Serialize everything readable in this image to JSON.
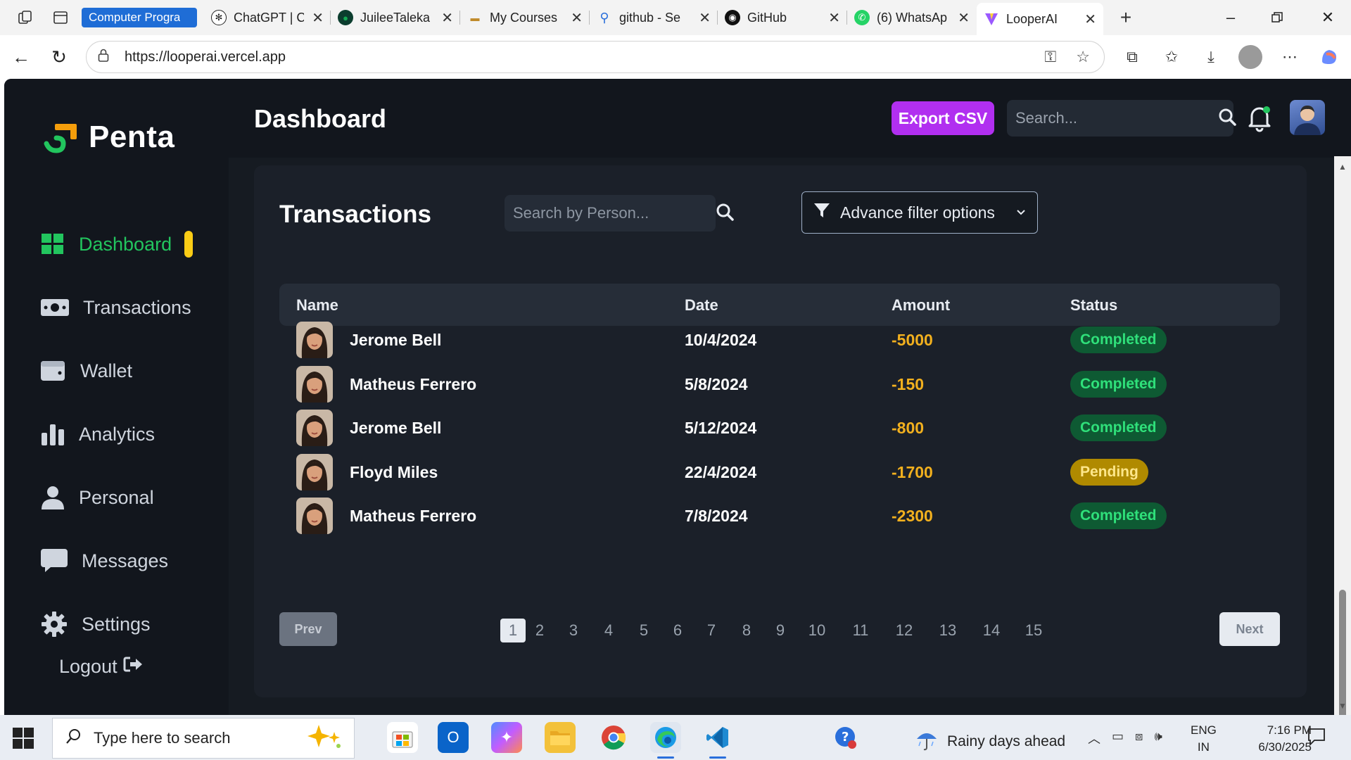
{
  "browser": {
    "tabs": [
      {
        "title": "Computer Progra",
        "favicon": "group",
        "color": "#1f6dd6"
      },
      {
        "title": "ChatGPT | C",
        "favicon": "chatgpt-icon",
        "color": "#222222"
      },
      {
        "title": "JuileeTaleka",
        "favicon": "mongodb-icon",
        "color": "#13aa52"
      },
      {
        "title": "My Courses",
        "favicon": "courses-icon",
        "color": "#c08a2a"
      },
      {
        "title": "github - Se",
        "favicon": "search-icon",
        "color": "#2a6fdb"
      },
      {
        "title": "GitHub",
        "favicon": "github-icon",
        "color": "#111111"
      },
      {
        "title": "(6) WhatsAp",
        "favicon": "whatsapp-icon",
        "color": "#25d366"
      },
      {
        "title": "LooperAI",
        "favicon": "vite-icon",
        "color": "#9b59ff"
      }
    ],
    "url": "https://looperai.vercel.app"
  },
  "app": {
    "brand": "Penta",
    "page_title": "Dashboard",
    "export_label": "Export CSV",
    "search_placeholder": "Search...",
    "sidebar": [
      {
        "label": "Dashboard",
        "icon": "grid-icon",
        "active": true
      },
      {
        "label": "Transactions",
        "icon": "money-icon",
        "active": false
      },
      {
        "label": "Wallet",
        "icon": "wallet-icon",
        "active": false
      },
      {
        "label": "Analytics",
        "icon": "bar-chart-icon",
        "active": false
      },
      {
        "label": "Personal",
        "icon": "user-icon",
        "active": false
      },
      {
        "label": "Messages",
        "icon": "message-icon",
        "active": false
      },
      {
        "label": "Settings",
        "icon": "gear-icon",
        "active": false
      }
    ],
    "logout_label": "Logout"
  },
  "transactions": {
    "title": "Transactions",
    "search_placeholder": "Search by Person...",
    "filter_label": "Advance filter options",
    "columns": [
      "Name",
      "Date",
      "Amount",
      "Status"
    ],
    "rows": [
      {
        "name": "Jerome Bell",
        "date": "10/4/2024",
        "amount": "-5000",
        "status": "Completed"
      },
      {
        "name": "Matheus Ferrero",
        "date": "5/8/2024",
        "amount": "-150",
        "status": "Completed"
      },
      {
        "name": "Jerome Bell",
        "date": "5/12/2024",
        "amount": "-800",
        "status": "Completed"
      },
      {
        "name": "Floyd Miles",
        "date": "22/4/2024",
        "amount": "-1700",
        "status": "Pending"
      },
      {
        "name": "Matheus Ferrero",
        "date": "7/8/2024",
        "amount": "-2300",
        "status": "Completed"
      }
    ],
    "prev_label": "Prev",
    "next_label": "Next",
    "pages": [
      "1",
      "2",
      "3",
      "4",
      "5",
      "6",
      "7",
      "8",
      "9",
      "10",
      "11",
      "12",
      "13",
      "14",
      "15"
    ],
    "current_page": "1"
  },
  "taskbar": {
    "search_placeholder": "Type here to search",
    "weather": "Rainy days ahead",
    "lang_top": "ENG",
    "lang_bottom": "IN",
    "time": "7:16 PM",
    "date": "6/30/2025"
  },
  "colors": {
    "accent_green": "#22c55e",
    "export_purple": "#b12ff0",
    "amount_orange": "#f2b01e",
    "pill_yellow": "#facc15"
  }
}
